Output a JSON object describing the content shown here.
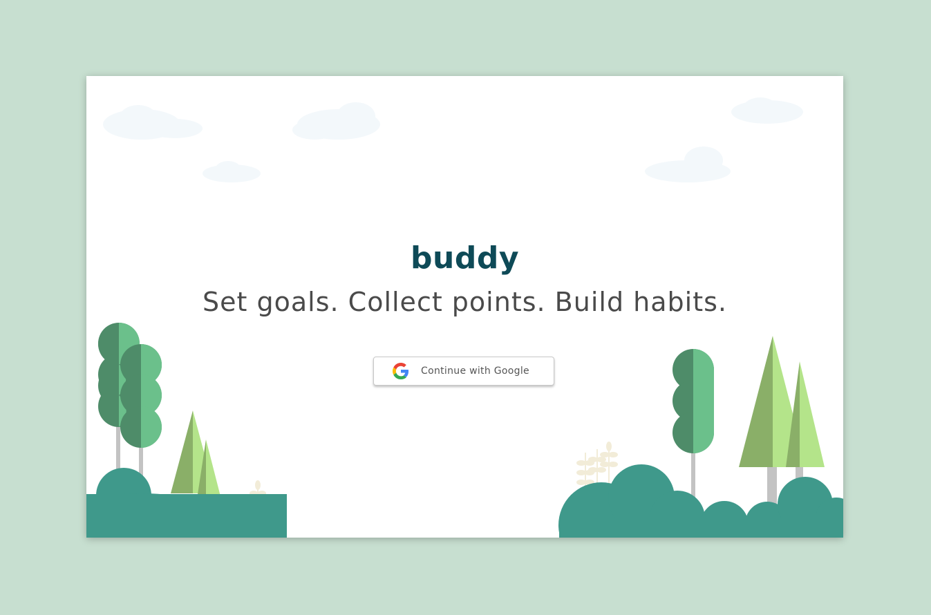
{
  "app": {
    "brand": "buddy",
    "tagline": "Set goals. Collect points. Build habits."
  },
  "auth": {
    "google_button_label": "Continue with Google",
    "provider_icon": "google-g-icon"
  },
  "colors": {
    "page_background": "#c7dfd0",
    "brand_text": "#0e4a57",
    "bush": "#3f998b",
    "tree_dark": "#4e8c69",
    "tree_light": "#6bc08b",
    "pine_dark": "#8aaf68",
    "pine_light": "#b4e48a"
  }
}
